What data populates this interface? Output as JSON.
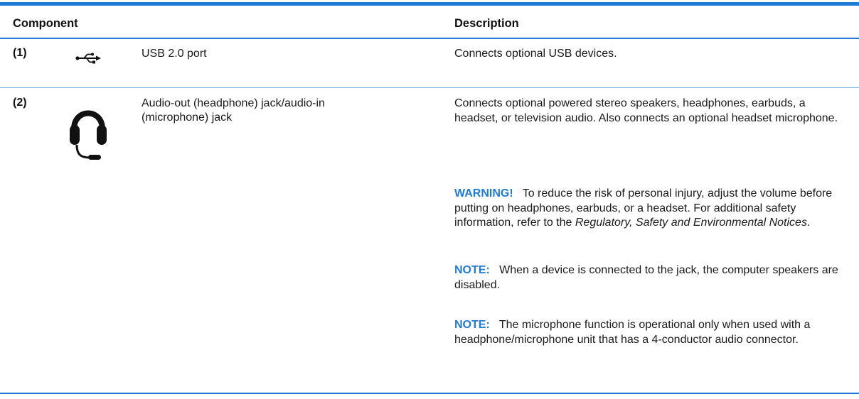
{
  "table": {
    "headers": {
      "component": "Component",
      "description": "Description"
    },
    "rows": [
      {
        "number": "(1)",
        "icon": "usb-icon",
        "component": "USB 2.0 port",
        "description": "Connects optional USB devices."
      },
      {
        "number": "(2)",
        "icon": "headset-icon",
        "component_line1": "Audio-out (headphone) jack/audio-in",
        "component_line2": "(microphone) jack",
        "description": "Connects optional powered stereo speakers, headphones, earbuds, a headset, or television audio. Also connects an optional headset microphone.",
        "warning": {
          "label": "WARNING!",
          "text": "To reduce the risk of personal injury, adjust the volume before putting on headphones, earbuds, or a headset. For additional safety information, refer to the ",
          "reference": "Regulatory, Safety and Environmental Notices",
          "end": "."
        },
        "notes": [
          {
            "label": "NOTE:",
            "text": "When a device is connected to the jack, the computer speakers are disabled."
          },
          {
            "label": "NOTE:",
            "text": "The microphone function is operational only when used with a headphone/microphone unit that has a 4-conductor audio connector."
          }
        ]
      }
    ]
  },
  "colors": {
    "accent": "#1f7bd6",
    "text": "#1a1a1a"
  }
}
